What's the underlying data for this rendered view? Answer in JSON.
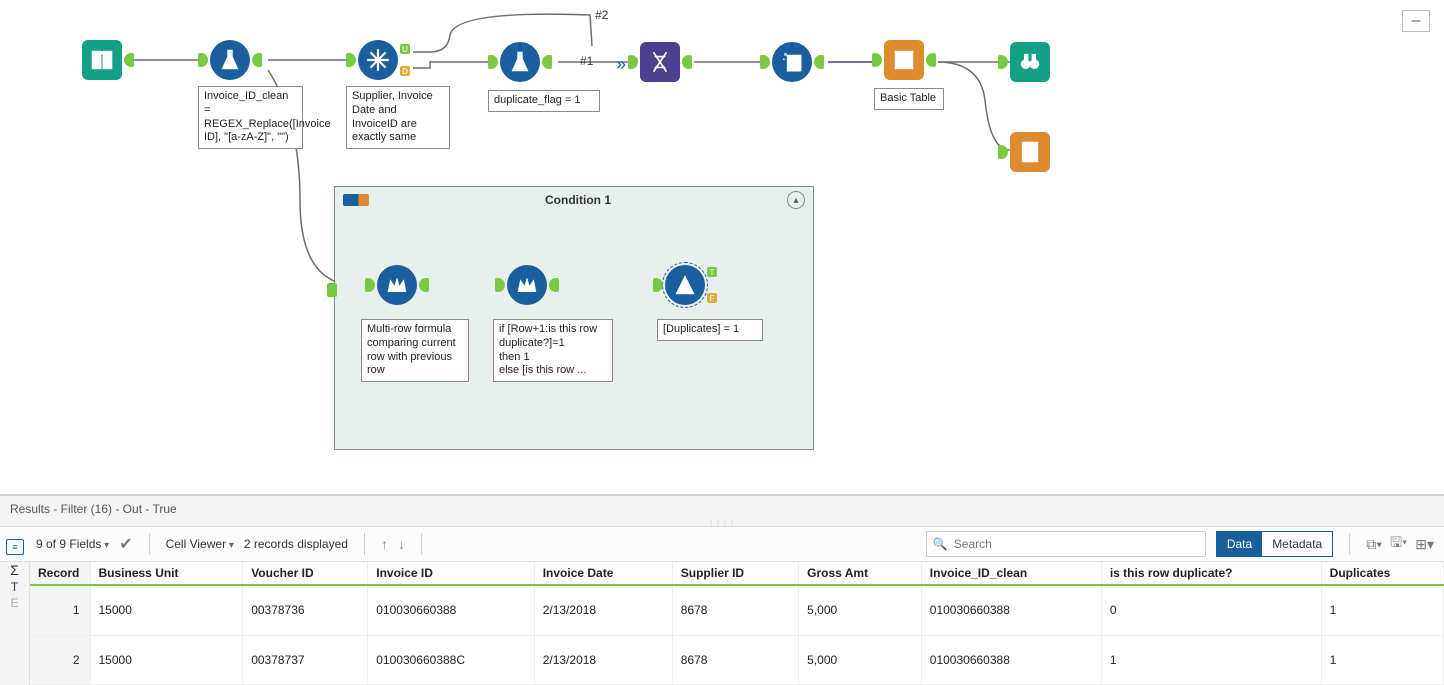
{
  "canvas": {
    "conn_labels": {
      "one": "#1",
      "two": "#2"
    },
    "tools": {
      "input": "input-data",
      "formula1": "formula",
      "unique": "unique",
      "formula2": "formula",
      "transpose": "transpose",
      "data_cleanse": "data-cleanse",
      "table": "table",
      "browse1": "browse",
      "browse2": "browse",
      "multirow1": "multi-row-formula",
      "multirow2": "multi-row-formula",
      "filter": "filter"
    },
    "port_letters": {
      "u": "U",
      "d": "D",
      "t": "T",
      "f": "F"
    },
    "annotations": {
      "anno1": "Invoice_ID_clean = REGEX_Replace([Invoice ID], \"[a-zA-Z]\", \"\")",
      "anno2": "Supplier, Invoice Date and InvoiceID are exactly same",
      "anno3": "duplicate_flag = 1",
      "basic_table": "Basic Table",
      "cond_title": "Condition 1",
      "anno4": "Multi-row formula comparing current row with previous row",
      "anno5": "if [Row+1:is this row duplicate?]=1\nthen 1\nelse [is this row ...",
      "anno6": "[Duplicates] = 1"
    }
  },
  "results": {
    "title": "Results - Filter (16) - Out - True",
    "fields_sel": "9 of 9 Fields",
    "cell_viewer": "Cell Viewer",
    "records_disp": "2 records displayed",
    "search_placeholder": "Search",
    "toggle": {
      "data": "Data",
      "metadata": "Metadata"
    },
    "columns": [
      "Record",
      "Business Unit",
      "Voucher ID",
      "Invoice ID",
      "Invoice Date",
      "Supplier ID",
      "Gross Amt",
      "Invoice_ID_clean",
      "is this row duplicate?",
      "Duplicates"
    ],
    "rows": [
      {
        "rec": "1",
        "bu": "15000",
        "voucher": "00378736",
        "inv": "010030660388",
        "date": "2/13/2018",
        "sup": "8678",
        "amt": "5,000",
        "clean": "010030660388",
        "dup": "0",
        "dups": "1"
      },
      {
        "rec": "2",
        "bu": "15000",
        "voucher": "00378737",
        "inv": "010030660388C",
        "date": "2/13/2018",
        "sup": "8678",
        "amt": "5,000",
        "clean": "010030660388",
        "dup": "1",
        "dups": "1"
      }
    ],
    "gutter_icons": {
      "sigma": "Σ",
      "t": "T",
      "e": "E",
      "lines": "≡"
    }
  },
  "minimize": "–"
}
